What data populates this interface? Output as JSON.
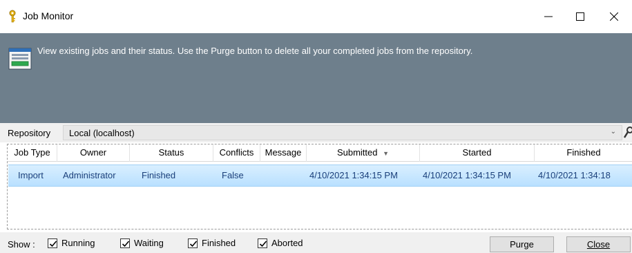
{
  "window": {
    "title": "Job Monitor",
    "controls": {
      "minimize": "—",
      "maximize": "☐",
      "close": "✕"
    }
  },
  "banner": {
    "text": "View existing jobs and their status. Use the Purge button to delete all your completed jobs from the repository.",
    "background": "#6e7f8c"
  },
  "repository": {
    "label": "Repository",
    "value": "Local  (localhost)"
  },
  "grid": {
    "columns": [
      "Job Type",
      "Owner",
      "Status",
      "Conflicts",
      "Message",
      "Submitted",
      "Started",
      "Finished"
    ],
    "sort_indicator": "▼",
    "rows": [
      {
        "job_type": "Import",
        "owner": "Administrator",
        "status": "Finished",
        "conflicts": "False",
        "message": "",
        "submitted": "4/10/2021 1:34:15 PM",
        "started": "4/10/2021 1:34:15 PM",
        "finished": "4/10/2021 1:34:18"
      }
    ],
    "selected_row_color": "#c6e6ff"
  },
  "filters": {
    "label": "Show :",
    "options": [
      {
        "label": "Running",
        "checked": true
      },
      {
        "label": "Waiting",
        "checked": true
      },
      {
        "label": "Finished",
        "checked": true
      },
      {
        "label": "Aborted",
        "checked": true
      }
    ]
  },
  "buttons": {
    "purge": "Purge",
    "close": "Close"
  },
  "icons": {
    "title_icon": "key-icon",
    "banner_icon": "job-list-icon",
    "search_icon": "search-icon"
  }
}
